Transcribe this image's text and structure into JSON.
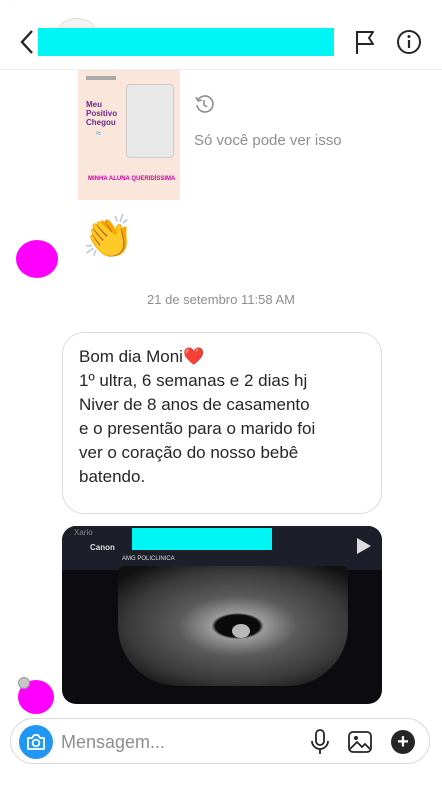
{
  "header": {
    "icons": {
      "back": "chevron-left-icon",
      "flag": "flag-icon",
      "info": "info-icon"
    }
  },
  "shared_post": {
    "title_text": "Meu Positivo Chegou",
    "pink_caption": "MINHA ALUNA QUERIDÍSSIMA",
    "visibility_note": "Só você pode ver isso"
  },
  "reaction_emoji": "👏",
  "timestamp": "21 de setembro 11:58 AM",
  "message": {
    "lines": [
      "Bom dia Moni",
      "1º ultra, 6 semanas e 2 dias hj",
      "Niver de 8 anos de casamento",
      "e o presentão para o marido foi",
      "ver o coração do nosso bebê",
      "batendo."
    ],
    "heart_emoji": "❤️"
  },
  "ultrasound": {
    "brand": "Canon",
    "model": "Xario",
    "clinic": "AMG POLICLINICA"
  },
  "composer": {
    "placeholder": "Mensagem...",
    "plus_label": "+"
  },
  "colors": {
    "redaction": "#00f5f5",
    "avatar_placeholder": "#ff00ff",
    "camera_button": "#2196f3"
  }
}
